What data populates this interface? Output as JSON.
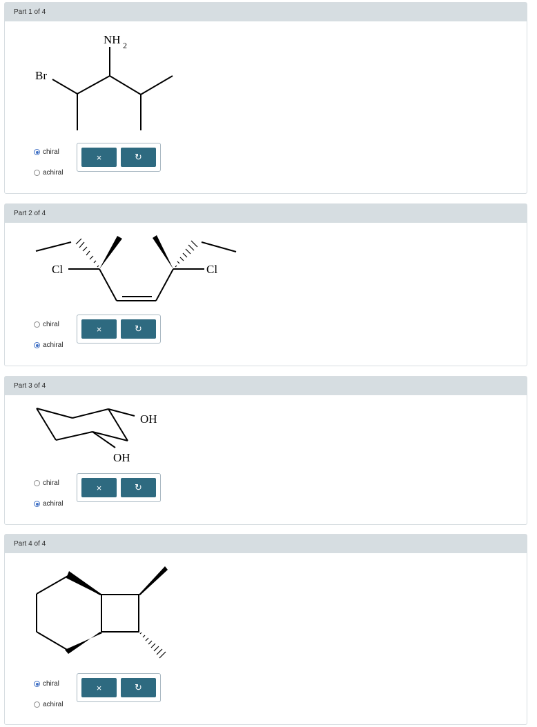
{
  "parts": [
    {
      "title": "Part 1 of 4",
      "molecule_labels": [
        "Br",
        "NH",
        "2"
      ],
      "options": [
        {
          "label": "chiral",
          "selected": true
        },
        {
          "label": "achiral",
          "selected": false
        }
      ],
      "clear_icon": "×",
      "undo_icon": "↻"
    },
    {
      "title": "Part 2 of 4",
      "molecule_labels": [
        "Cl",
        "Cl"
      ],
      "options": [
        {
          "label": "chiral",
          "selected": false
        },
        {
          "label": "achiral",
          "selected": true
        }
      ],
      "clear_icon": "×",
      "undo_icon": "↻"
    },
    {
      "title": "Part 3 of 4",
      "molecule_labels": [
        "OH",
        "OH"
      ],
      "options": [
        {
          "label": "chiral",
          "selected": false
        },
        {
          "label": "achiral",
          "selected": true
        }
      ],
      "clear_icon": "×",
      "undo_icon": "↻"
    },
    {
      "title": "Part 4 of 4",
      "molecule_labels": [],
      "options": [
        {
          "label": "chiral",
          "selected": true
        },
        {
          "label": "achiral",
          "selected": false
        }
      ],
      "clear_icon": "×",
      "undo_icon": "↻"
    }
  ]
}
